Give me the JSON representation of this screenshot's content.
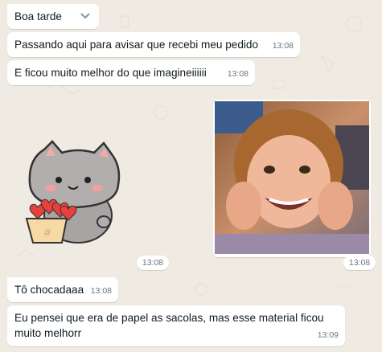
{
  "messages": [
    {
      "text": "Boa tarde",
      "time": ""
    },
    {
      "text": "Passando aqui para avisar que recebi meu pedido",
      "time": "13:08"
    },
    {
      "text": "E ficou muito melhor do que imagineiiiiii",
      "time": "13:08"
    },
    {
      "sticker": "cat-with-hearts-sticker",
      "time": "13:08"
    },
    {
      "image": "smiling-child-photo",
      "time": "13:08"
    },
    {
      "text": "Tô chocadaaa",
      "time": "13:08"
    },
    {
      "text_line1": "Eu pensei que era de papel as sacolas, mas esse material ficou",
      "text_line2": "muito melhorr",
      "time": "13:09"
    }
  ],
  "colors": {
    "chat_bg": "#efeae2",
    "bubble": "#ffffff",
    "timestamp": "#667781",
    "text": "#111b21"
  }
}
